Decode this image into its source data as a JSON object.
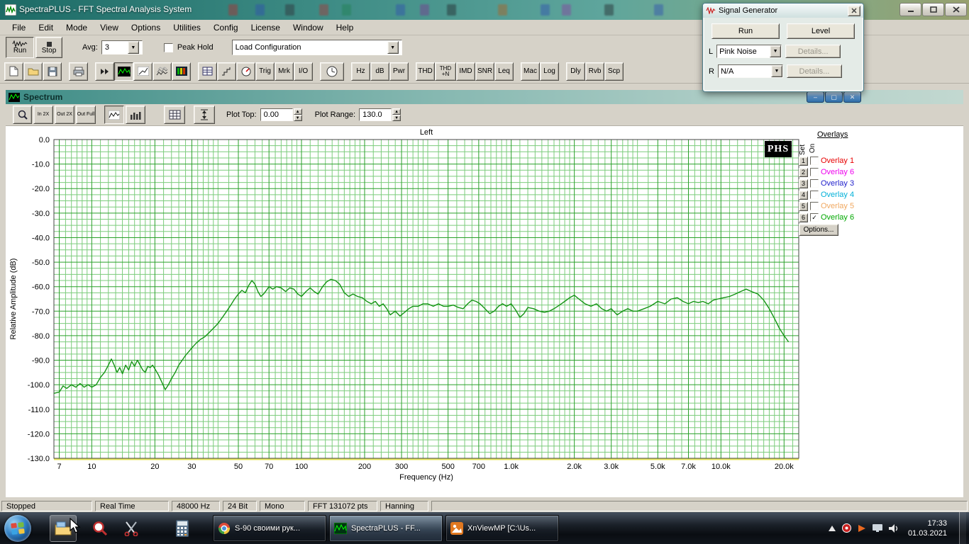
{
  "titlebar": {
    "title": "SpectraPLUS - FFT Spectral Analysis System"
  },
  "menu": {
    "items": [
      "File",
      "Edit",
      "Mode",
      "View",
      "Options",
      "Utilities",
      "Config",
      "License",
      "Window",
      "Help"
    ]
  },
  "transport": {
    "run_label": "Run",
    "stop_label": "Stop",
    "avg_label": "Avg:",
    "avg_value": "3",
    "peak_hold_label": "Peak Hold",
    "load_config_value": "Load Configuration"
  },
  "toolbar": {
    "trig": "Trig",
    "mrk": "Mrk",
    "io": "I/O",
    "hz": "Hz",
    "db": "dB",
    "pwr": "Pwr",
    "thd": "THD",
    "thdn": "THD +N",
    "imd": "IMD",
    "snr": "SNR",
    "leq": "Leq",
    "mac": "Mac",
    "log": "Log",
    "dly": "Dly",
    "rvb": "Rvb",
    "scp": "Scp"
  },
  "signal_generator": {
    "title": "Signal Generator",
    "run_label": "Run",
    "level_label": "Level",
    "left_label": "L",
    "left_value": "Pink Noise",
    "details_left": "Details...",
    "right_label": "R",
    "right_value": "N/A",
    "details_right": "Details..."
  },
  "spectrum_window": {
    "title": "Spectrum",
    "zoom_in": "In 2X",
    "zoom_out": "Out 2X",
    "zoom_full": "Out Full",
    "plot_top_label": "Plot Top:",
    "plot_top_value": "0.00",
    "plot_range_label": "Plot Range:",
    "plot_range_value": "130.0",
    "phs_badge": "PHS"
  },
  "overlays": {
    "title": "Overlays",
    "set_label": "Set",
    "on_label": "On",
    "options_label": "Options...",
    "items": [
      {
        "num": "1",
        "label": "Overlay 1",
        "color": "#e80000",
        "checked": false
      },
      {
        "num": "2",
        "label": "Overlay 6",
        "color": "#ee00ee",
        "checked": false
      },
      {
        "num": "3",
        "label": "Overlay 3",
        "color": "#2222cc",
        "checked": false
      },
      {
        "num": "4",
        "label": "Overlay 4",
        "color": "#00b0d8",
        "checked": false
      },
      {
        "num": "5",
        "label": "Overlay 5",
        "color": "#f0a860",
        "checked": false
      },
      {
        "num": "6",
        "label": "Overlay 6",
        "color": "#00a800",
        "checked": true
      }
    ]
  },
  "chart_data": {
    "type": "line",
    "title": "Left",
    "xlabel": "Frequency (Hz)",
    "ylabel": "Relative Amplitude (dB)",
    "x_scale": "log",
    "x_range": [
      6.6,
      23500
    ],
    "ylim": [
      -130,
      0
    ],
    "y_major_step": 10,
    "y_minor_step": 2.5,
    "x_tick_values": [
      7,
      10,
      20,
      30,
      50,
      70,
      100,
      200,
      300,
      500,
      700,
      1000,
      2000,
      3000,
      5000,
      7000,
      10000,
      20000
    ],
    "x_tick_labels": [
      "7",
      "10",
      "20",
      "30",
      "50",
      "70",
      "100",
      "200",
      "300",
      "500",
      "700",
      "1.0k",
      "2.0k",
      "3.0k",
      "5.0k",
      "7.0k",
      "10.0k",
      "20.0k"
    ],
    "colors": {
      "line": "#149414",
      "grid_major": "#2aa02a",
      "grid_minor": "#7ccc7c",
      "baseline": "#e6e65a",
      "frame": "#444444"
    },
    "series": [
      {
        "name": "Left",
        "points": [
          [
            6.6,
            -103.5
          ],
          [
            7,
            -103
          ],
          [
            7.3,
            -100.5
          ],
          [
            7.6,
            -101.5
          ],
          [
            8,
            -100
          ],
          [
            8.4,
            -101
          ],
          [
            8.8,
            -99.5
          ],
          [
            9.2,
            -101
          ],
          [
            9.6,
            -100
          ],
          [
            10,
            -101
          ],
          [
            10.5,
            -100
          ],
          [
            11,
            -97
          ],
          [
            11.5,
            -95
          ],
          [
            12,
            -92
          ],
          [
            12.4,
            -89.5
          ],
          [
            12.8,
            -92
          ],
          [
            13.2,
            -95
          ],
          [
            13.6,
            -93
          ],
          [
            14,
            -95.5
          ],
          [
            14.5,
            -92
          ],
          [
            15,
            -94
          ],
          [
            15.5,
            -90.5
          ],
          [
            16,
            -92.5
          ],
          [
            16.5,
            -90
          ],
          [
            17,
            -92
          ],
          [
            17.5,
            -94
          ],
          [
            18,
            -95
          ],
          [
            18.5,
            -92.5
          ],
          [
            19,
            -93
          ],
          [
            19.5,
            -92
          ],
          [
            20,
            -93.5
          ],
          [
            20.8,
            -96
          ],
          [
            21.6,
            -99
          ],
          [
            22.4,
            -102
          ],
          [
            23.2,
            -100
          ],
          [
            24,
            -97.5
          ],
          [
            25,
            -95
          ],
          [
            26,
            -92
          ],
          [
            27,
            -90
          ],
          [
            28,
            -88
          ],
          [
            29,
            -86.5
          ],
          [
            30,
            -85
          ],
          [
            31.5,
            -83
          ],
          [
            33,
            -81.5
          ],
          [
            34.5,
            -80.5
          ],
          [
            36,
            -79
          ],
          [
            38,
            -77
          ],
          [
            40,
            -75
          ],
          [
            42,
            -72.5
          ],
          [
            44,
            -70
          ],
          [
            46,
            -67.5
          ],
          [
            48,
            -65
          ],
          [
            50,
            -63
          ],
          [
            52,
            -61.5
          ],
          [
            54,
            -62.5
          ],
          [
            56,
            -59.5
          ],
          [
            58,
            -57.5
          ],
          [
            60,
            -59
          ],
          [
            62,
            -62
          ],
          [
            64,
            -64
          ],
          [
            66,
            -63
          ],
          [
            68,
            -61.5
          ],
          [
            70,
            -60
          ],
          [
            73,
            -61
          ],
          [
            76,
            -60
          ],
          [
            80,
            -60.5
          ],
          [
            84,
            -62
          ],
          [
            88,
            -60.5
          ],
          [
            92,
            -61
          ],
          [
            96,
            -63
          ],
          [
            100,
            -64
          ],
          [
            105,
            -62
          ],
          [
            110,
            -60.5
          ],
          [
            115,
            -62
          ],
          [
            120,
            -63
          ],
          [
            126,
            -60
          ],
          [
            132,
            -58
          ],
          [
            138,
            -57
          ],
          [
            145,
            -57.5
          ],
          [
            152,
            -59
          ],
          [
            160,
            -62.5
          ],
          [
            168,
            -64
          ],
          [
            176,
            -63
          ],
          [
            185,
            -64
          ],
          [
            195,
            -64.5
          ],
          [
            205,
            -66
          ],
          [
            215,
            -67
          ],
          [
            225,
            -66
          ],
          [
            235,
            -68
          ],
          [
            245,
            -67
          ],
          [
            255,
            -69
          ],
          [
            265,
            -71.5
          ],
          [
            280,
            -70
          ],
          [
            295,
            -72
          ],
          [
            310,
            -70.5
          ],
          [
            325,
            -69
          ],
          [
            340,
            -68
          ],
          [
            360,
            -68
          ],
          [
            380,
            -67
          ],
          [
            400,
            -67
          ],
          [
            425,
            -68
          ],
          [
            450,
            -67
          ],
          [
            475,
            -68
          ],
          [
            500,
            -68
          ],
          [
            530,
            -67.5
          ],
          [
            560,
            -68.5
          ],
          [
            590,
            -69
          ],
          [
            620,
            -67
          ],
          [
            650,
            -65.5
          ],
          [
            680,
            -66
          ],
          [
            710,
            -67
          ],
          [
            750,
            -69
          ],
          [
            790,
            -71
          ],
          [
            830,
            -70
          ],
          [
            870,
            -68
          ],
          [
            910,
            -67
          ],
          [
            950,
            -68
          ],
          [
            1000,
            -67
          ],
          [
            1050,
            -69.5
          ],
          [
            1100,
            -72.5
          ],
          [
            1150,
            -71
          ],
          [
            1200,
            -68.5
          ],
          [
            1280,
            -69
          ],
          [
            1360,
            -70
          ],
          [
            1440,
            -70.5
          ],
          [
            1520,
            -70
          ],
          [
            1600,
            -69
          ],
          [
            1700,
            -67.5
          ],
          [
            1800,
            -66
          ],
          [
            1900,
            -64.5
          ],
          [
            2000,
            -63.5
          ],
          [
            2100,
            -65
          ],
          [
            2250,
            -67
          ],
          [
            2400,
            -68
          ],
          [
            2550,
            -67
          ],
          [
            2700,
            -69
          ],
          [
            2850,
            -70
          ],
          [
            3000,
            -69
          ],
          [
            3200,
            -71.5
          ],
          [
            3400,
            -70
          ],
          [
            3600,
            -69
          ],
          [
            3800,
            -70
          ],
          [
            4000,
            -70
          ],
          [
            4300,
            -69
          ],
          [
            4600,
            -68
          ],
          [
            5000,
            -66
          ],
          [
            5400,
            -67
          ],
          [
            5800,
            -65
          ],
          [
            6200,
            -64.5
          ],
          [
            6600,
            -66
          ],
          [
            7000,
            -67
          ],
          [
            7400,
            -66
          ],
          [
            7800,
            -66.5
          ],
          [
            8200,
            -66
          ],
          [
            8700,
            -67
          ],
          [
            9200,
            -65.5
          ],
          [
            9700,
            -65
          ],
          [
            10300,
            -64.5
          ],
          [
            11000,
            -64
          ],
          [
            11700,
            -63
          ],
          [
            12400,
            -62
          ],
          [
            13200,
            -61
          ],
          [
            14000,
            -62
          ],
          [
            15000,
            -63
          ],
          [
            16000,
            -65.5
          ],
          [
            17000,
            -69
          ],
          [
            18000,
            -73
          ],
          [
            19000,
            -77
          ],
          [
            20000,
            -80
          ],
          [
            21000,
            -82.5
          ]
        ]
      }
    ]
  },
  "status_bar": {
    "segments": [
      "Stopped",
      "Real Time",
      "48000 Hz",
      "24 Bit",
      "Mono",
      "FFT 131072 pts",
      "Hanning"
    ]
  },
  "taskbar": {
    "windows": [
      {
        "label": "S-90 своими рук..."
      },
      {
        "label": "SpectraPLUS - FF..."
      },
      {
        "label": "XnViewMP [C:\\Us..."
      }
    ],
    "time": "17:33",
    "date": "01.03.2021"
  }
}
